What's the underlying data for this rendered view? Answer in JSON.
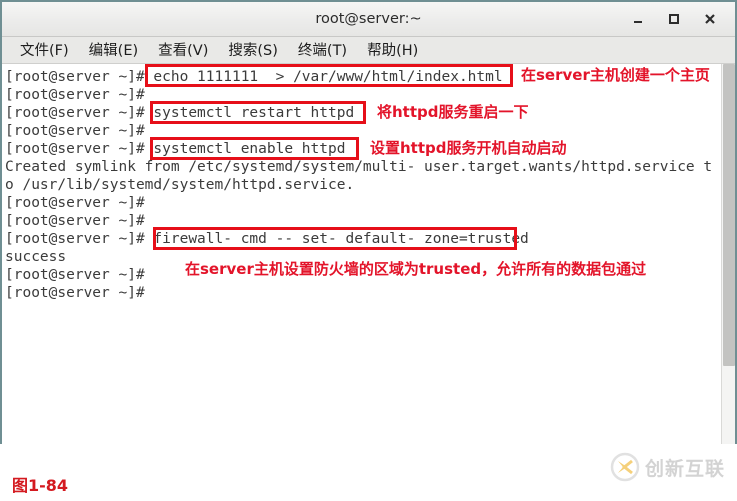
{
  "window": {
    "title": "root@server:~",
    "buttons": [
      {
        "name": "minimize",
        "glyph": "_"
      },
      {
        "name": "maximize",
        "glyph": "■"
      },
      {
        "name": "close",
        "glyph": "✕"
      }
    ]
  },
  "menubar": {
    "items": [
      {
        "label": "文件(F)"
      },
      {
        "label": "编辑(E)"
      },
      {
        "label": "查看(V)"
      },
      {
        "label": "搜索(S)"
      },
      {
        "label": "终端(T)"
      },
      {
        "label": "帮助(H)"
      }
    ]
  },
  "terminal": {
    "prompt": "[root@server ~]# ",
    "lines": [
      {
        "text": "[root@server ~]# echo 1111111  > /var/www/html/index.html"
      },
      {
        "text": "[root@server ~]# "
      },
      {
        "text": "[root@server ~]# systemctl restart httpd"
      },
      {
        "text": "[root@server ~]# "
      },
      {
        "text": "[root@server ~]# systemctl enable httpd"
      },
      {
        "text": "Created symlink from /etc/systemd/system/multi- user.target.wants/httpd.service t"
      },
      {
        "text": "o /usr/lib/systemd/system/httpd.service."
      },
      {
        "text": "[root@server ~]# "
      },
      {
        "text": "[root@server ~]# "
      },
      {
        "text": "[root@server ~]# firewall- cmd -- set- default- zone=trusted"
      },
      {
        "text": "success"
      },
      {
        "text": "[root@server ~]# "
      },
      {
        "text": "[root@server ~]# "
      }
    ]
  },
  "annotations": {
    "boxes": [
      {
        "name": "echo-command-box",
        "label": "echo 1111111  > /var/www/html/index.html"
      },
      {
        "name": "systemctl-restart-box",
        "label": "systemctl restart httpd"
      },
      {
        "name": "systemctl-enable-box",
        "label": "systemctl enable httpd"
      },
      {
        "name": "firewall-cmd-box",
        "label": "firewall- cmd -- set- default- zone=trusted"
      }
    ],
    "notes": [
      {
        "name": "note-create-homepage",
        "text": "在server主机创建一个主页"
      },
      {
        "name": "note-restart-httpd",
        "text": "将httpd服务重启一下"
      },
      {
        "name": "note-enable-httpd",
        "text": "设置httpd服务开机自动启动"
      },
      {
        "name": "note-firewall-trusted",
        "text": "在server主机设置防火墙的区域为trusted，允许所有的数据包通过"
      }
    ]
  },
  "caption": {
    "text": "图1-84"
  },
  "watermark": {
    "text": "创新互联"
  },
  "colors": {
    "annotation_red": "#e60f19",
    "annotation_text_red": "#e3142a",
    "caption_red": "#d41a20",
    "window_border": "#6f8f93",
    "terminal_text": "#3b3b3b",
    "watermark_gray": "#b9b9b9",
    "watermark_yellow": "#f0b429"
  }
}
